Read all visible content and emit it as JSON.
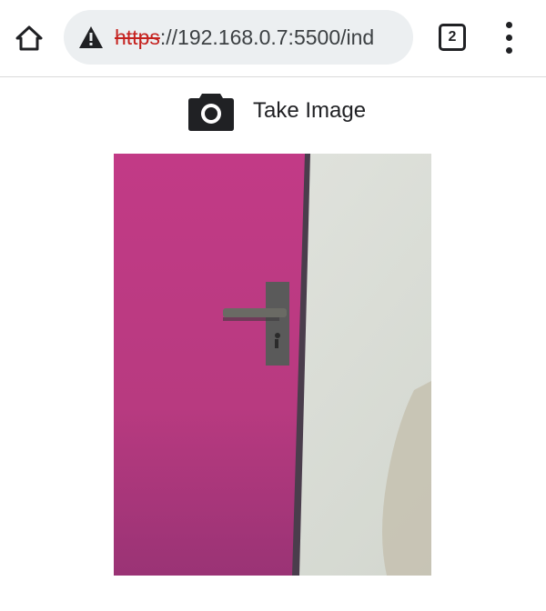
{
  "browser": {
    "url_scheme": "https",
    "url_rest": "://192.168.0.7:5500/ind",
    "tab_count": "2",
    "security_state": "not-secure-warning-icon"
  },
  "page": {
    "capture_label": "Take Image",
    "camera_icon": "camera-icon",
    "photo_subject": "captured-photo"
  },
  "colors": {
    "door": "#c23c84",
    "wall": "#dfe3de",
    "warning": "#c5221f"
  }
}
